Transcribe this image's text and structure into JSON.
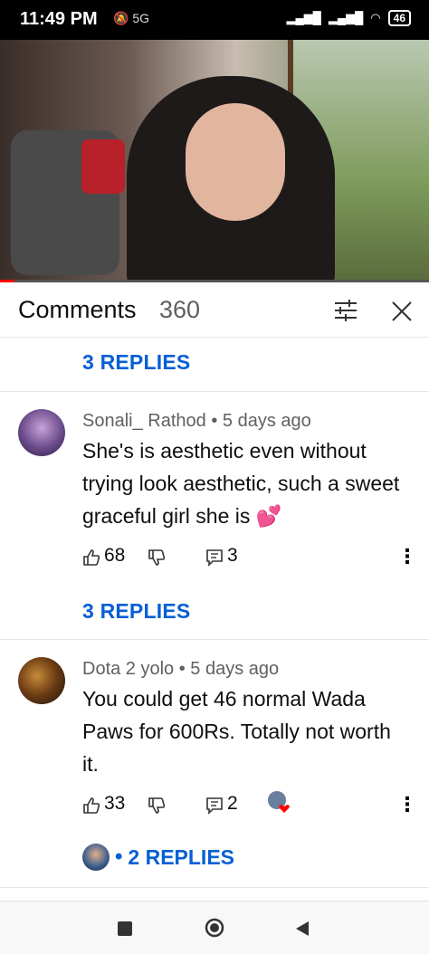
{
  "status_bar": {
    "time": "11:49 PM",
    "extra": "5G",
    "battery": "46"
  },
  "comments_header": {
    "title": "Comments",
    "count": "360"
  },
  "top_replies": "3 REPLIES",
  "comments": [
    {
      "author": "Sonali_ Rathod",
      "time": "• 5 days ago",
      "text": "She's is aesthetic even without trying look aesthetic, such a sweet graceful girl she is 💕",
      "likes": "68",
      "replies_count": "3",
      "replies_label": "3 REPLIES"
    },
    {
      "author": "Dota 2 yolo",
      "time": "• 5 days ago",
      "text": "You could get 46 normal Wada Paws  for 600Rs. Totally not worth it.",
      "likes": "33",
      "replies_count": "2",
      "replies_label": "2 REPLIES"
    }
  ],
  "icons": {
    "filter": "filter-icon",
    "close": "close-icon",
    "like": "thumb-up-icon",
    "dislike": "thumb-down-icon",
    "reply": "reply-icon",
    "more": "more-vertical-icon"
  },
  "colors": {
    "link": "#065fd4",
    "progress": "#ff0000"
  }
}
